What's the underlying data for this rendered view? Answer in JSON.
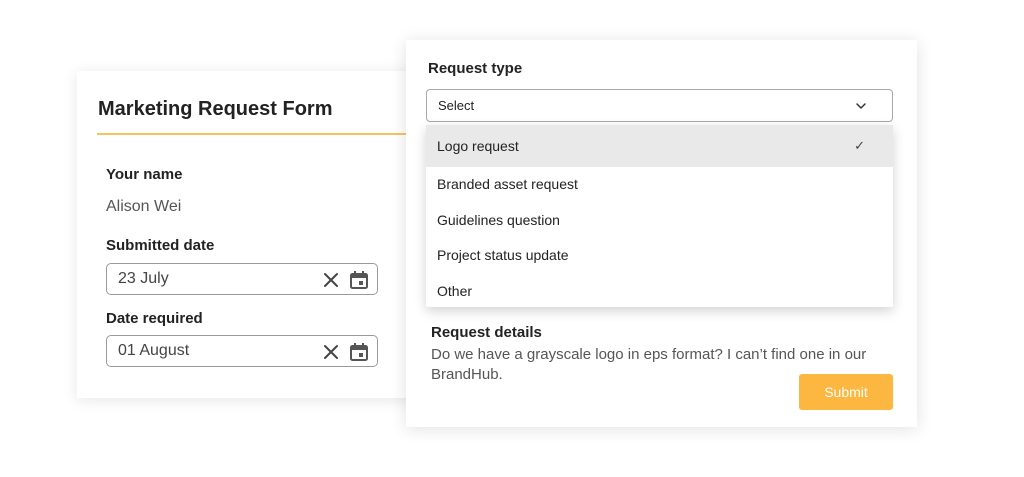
{
  "form": {
    "title": "Marketing Request Form",
    "accent_color": "#f7c35f"
  },
  "fields": {
    "your_name": {
      "label": "Your name",
      "value": "Alison Wei"
    },
    "submitted_date": {
      "label": "Submitted date",
      "value": "23 July"
    },
    "date_required": {
      "label": "Date required",
      "value": "01 August"
    }
  },
  "request_type": {
    "label": "Request type",
    "selected_display": "Select",
    "options": [
      {
        "label": "Logo request",
        "selected": true
      },
      {
        "label": "Branded asset request",
        "selected": false
      },
      {
        "label": "Guidelines question",
        "selected": false
      },
      {
        "label": "Project status update",
        "selected": false
      },
      {
        "label": "Other",
        "selected": false
      }
    ],
    "check_glyph": "✓"
  },
  "request_details": {
    "label": "Request details",
    "text": "Do we have a grayscale logo in eps format? I can’t find one in our BrandHub."
  },
  "submit": {
    "label": "Submit",
    "color": "#fbb73f"
  },
  "icons": {
    "clear": "close-icon",
    "calendar": "calendar-icon",
    "chevron": "chevron-down-icon",
    "check": "check-icon"
  }
}
